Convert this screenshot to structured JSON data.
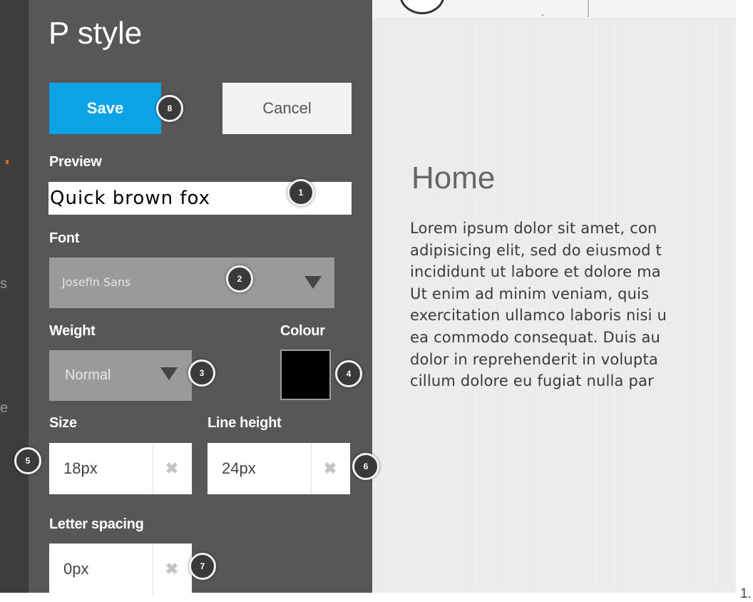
{
  "panel": {
    "title": "P style",
    "save_label": "Save",
    "cancel_label": "Cancel",
    "preview_label": "Preview",
    "preview_value": "Quick brown fox",
    "font_label": "Font",
    "font_value": "Josefin Sans",
    "weight_label": "Weight",
    "weight_value": "Normal",
    "colour_label": "Colour",
    "colour_value": "#000000",
    "size_label": "Size",
    "size_value": "18px",
    "line_height_label": "Line height",
    "line_height_value": "24px",
    "letter_spacing_label": "Letter spacing",
    "letter_spacing_value": "0px",
    "clear_icon": "✖",
    "clear_icon_name": "clear-x-icon",
    "dropdown_icon_name": "triangle-down-icon"
  },
  "badges": [
    "1",
    "2",
    "3",
    "4",
    "5",
    "6",
    "7",
    "8"
  ],
  "canvas": {
    "heading": "Home",
    "lines": [
      "Lorem ipsum dolor sit amet, con",
      "adipisicing elit, sed do eiusmod t",
      "incididunt ut labore et dolore ma",
      "Ut enim ad minim veniam, quis",
      "exercitation ullamco laboris nisi u",
      "ea commodo consequat. Duis au",
      "dolor in reprehenderit in volupta",
      "cillum dolore eu fugiat nulla par"
    ]
  },
  "page_number": "1.",
  "colors": {
    "accent": "#0ba3e6",
    "panel_bg": "#575757",
    "strip_bg": "#3d3d3d",
    "canvas_bg": "#efefef"
  }
}
